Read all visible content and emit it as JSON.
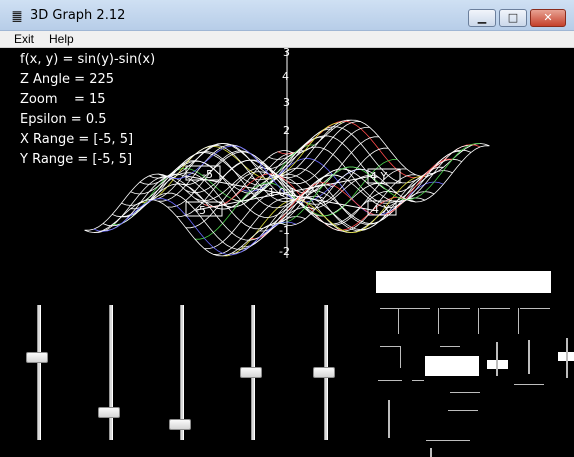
{
  "window": {
    "title": "3D Graph 2.12",
    "icon": "app-icon",
    "controls": [
      "minimize-icon",
      "maximize-icon",
      "close-icon"
    ]
  },
  "menu": {
    "exit": "Exit",
    "help": "Help"
  },
  "info": {
    "function": "f(x, y) = sin(y)-sin(x)",
    "z_angle": "Z Angle = 225",
    "zoom": "Zoom    = 15",
    "epsilon": "Epsilon = 0.5",
    "x_range": "X Range = [-5, 5]",
    "y_range": "Y Range = [-5, 5]"
  },
  "axis_labels": {
    "z_top": "3",
    "z_4": "4",
    "z_3": "3",
    "z_2": "2",
    "z_neg1": "-1",
    "z_neg2": "-2",
    "neg_x": "-5",
    "neg_y": "-5",
    "pos_y": "4 Y",
    "pos_x": "4 X",
    "center": "1 0 1"
  },
  "sliders": [
    {
      "name": "slider-1",
      "value": 0.62
    },
    {
      "name": "slider-2",
      "value": 0.18
    },
    {
      "name": "slider-3",
      "value": 0.08
    },
    {
      "name": "slider-4",
      "value": 0.5
    },
    {
      "name": "slider-5",
      "value": 0.5
    }
  ],
  "colors": {
    "background": "#000000",
    "text": "#ffffff",
    "mesh_primary": "#ffffff",
    "mesh_accent_1": "#ff4a4a",
    "mesh_accent_2": "#4ad04a",
    "mesh_accent_3": "#6a6aff",
    "mesh_accent_4": "#e0e040"
  }
}
